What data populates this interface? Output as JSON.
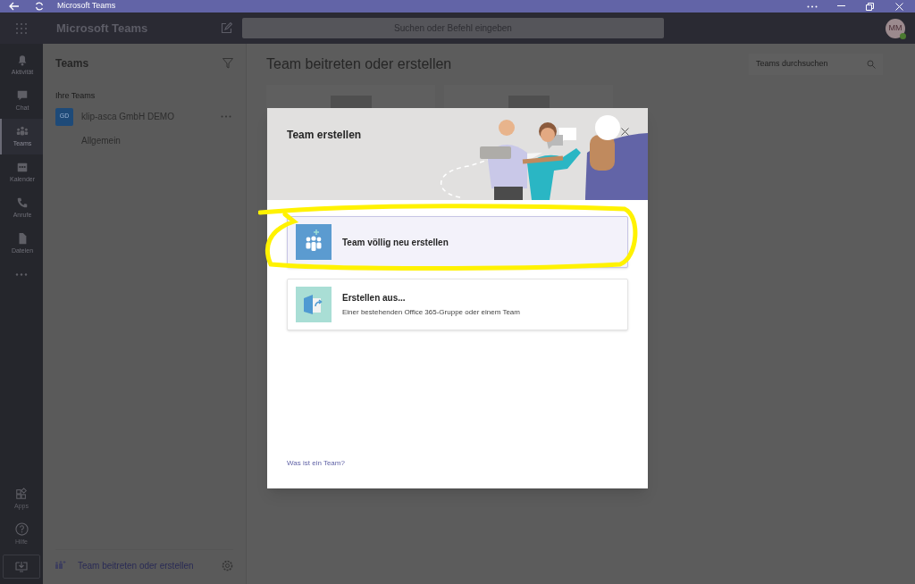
{
  "title_bar": {
    "title": "Microsoft Teams"
  },
  "header": {
    "app_name": "Microsoft Teams",
    "search": {
      "placeholder": "Suchen oder Befehl eingeben"
    },
    "avatar": "MM"
  },
  "rail": {
    "items": [
      {
        "kind": "bell",
        "label": "Aktivität",
        "selected": false
      },
      {
        "kind": "chat",
        "label": "Chat",
        "selected": false
      },
      {
        "kind": "teams",
        "label": "Teams",
        "selected": true
      },
      {
        "kind": "calendar",
        "label": "Kalender",
        "selected": false
      },
      {
        "kind": "phone",
        "label": "Anrufe",
        "selected": false
      },
      {
        "kind": "file",
        "label": "Dateien",
        "selected": false
      }
    ],
    "bottom_items": [
      {
        "kind": "apps",
        "label": "Apps"
      },
      {
        "kind": "help",
        "label": "Hilfe"
      }
    ]
  },
  "teams_panel": {
    "title": "Teams",
    "section": "Ihre Teams",
    "teams": [
      {
        "initials": "GD",
        "name": "klip-asca GmbH DEMO",
        "channels": [
          "Allgemein"
        ]
      }
    ],
    "footer": "Team beitreten oder erstellen"
  },
  "main": {
    "title": "Team beitreten oder erstellen",
    "search": {
      "placeholder": "Teams durchsuchen"
    }
  },
  "dialog": {
    "title": "Team erstellen",
    "options": [
      {
        "kind": "new",
        "title": "Team völlig neu erstellen",
        "selected": true
      },
      {
        "kind": "from",
        "title": "Erstellen aus...",
        "subtitle": "Einer bestehenden Office 365-Gruppe oder einem Team",
        "selected": false
      }
    ],
    "link": "Was ist ein Team?"
  }
}
